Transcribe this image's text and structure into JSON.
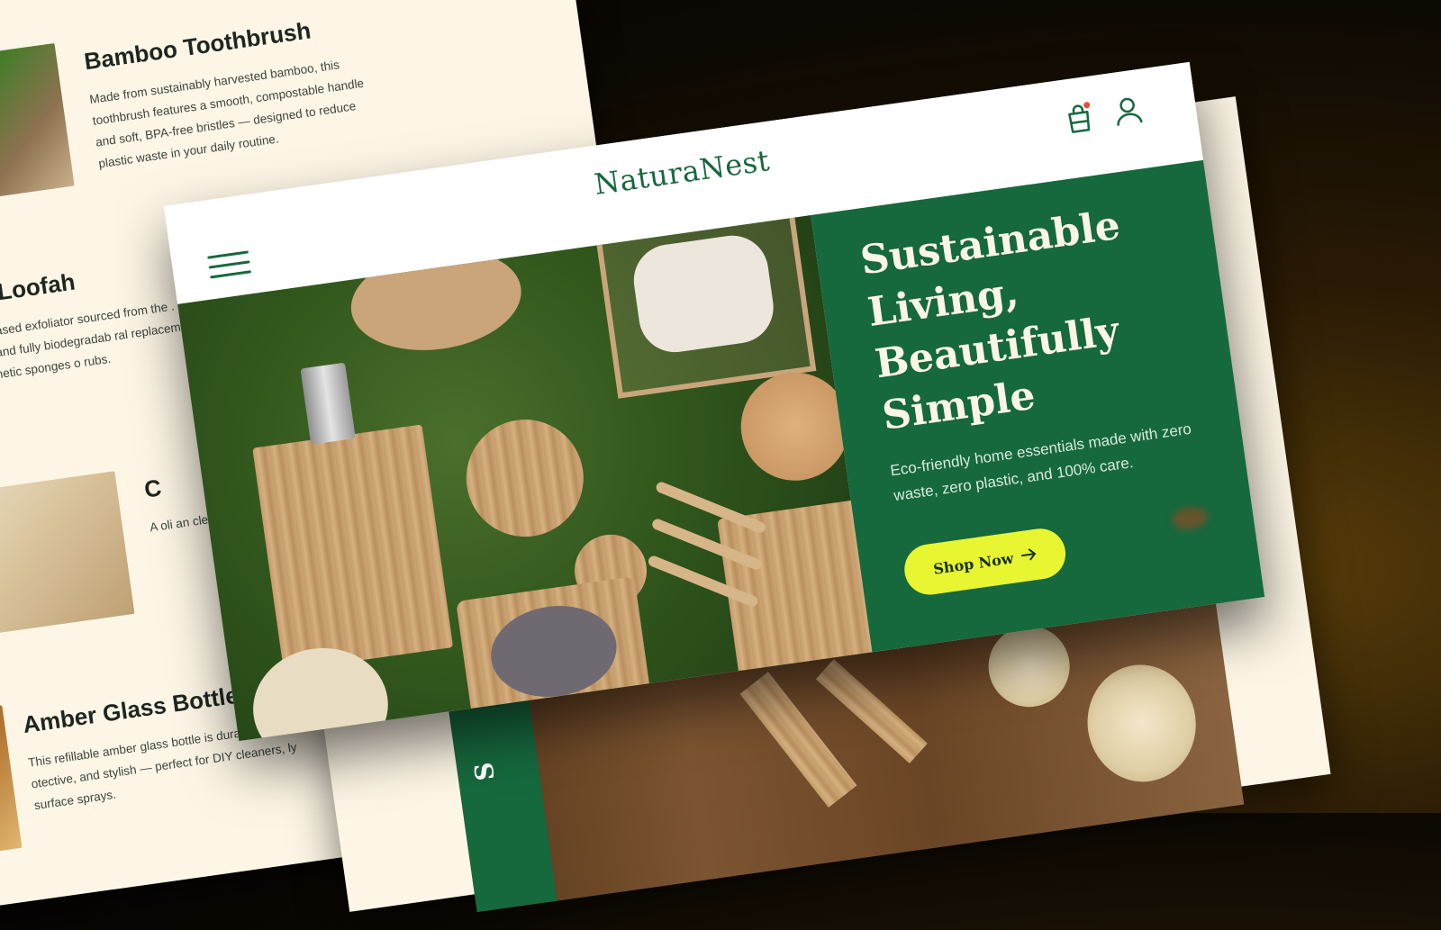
{
  "product_list": {
    "items": [
      {
        "title": "Bamboo Toothbrush",
        "description": "Made from sustainably harvested bamboo, this toothbrush features a smooth, compostable handle and soft, BPA-free bristles — designed to reduce plastic waste in your daily routine."
      },
      {
        "title": "ral Loofah",
        "description": "ant-based exfoliator sourced from the . Gentle on skin and fully biodegradab ral replacement for synthetic sponges o rubs."
      },
      {
        "title": "C",
        "description": "A oli an cle"
      },
      {
        "title": "Amber Glass Bottle",
        "description": "This refillable amber glass bottle is durable, UV- otective, and stylish — perfect for DIY cleaners, ly surface sprays."
      }
    ]
  },
  "header": {
    "logo": "NaturaNest",
    "menu_icon": "hamburger-menu-icon",
    "cart_icon": "shopping-bag-icon",
    "account_icon": "user-icon"
  },
  "hero": {
    "heading_lines": [
      "Sustainable",
      "Living,",
      "Beautifully",
      "Simple"
    ],
    "subtitle": "Eco-friendly home essentials made with zero waste, zero plastic, and 100% care.",
    "cta_label": "Shop Now",
    "cta_icon": "arrow-right-icon"
  },
  "secondary_section": {
    "vertical_label": "S"
  },
  "colors": {
    "brand_green": "#16683d",
    "cta_yellow": "#e8f531",
    "cream": "#fdf6e6",
    "notification_red": "#e74c3c"
  }
}
